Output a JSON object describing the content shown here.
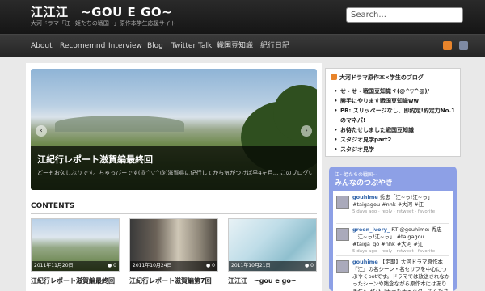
{
  "header": {
    "title": "江江江　~GOU E GO~",
    "tagline": "大河ドラマ「江~姫たちの戦国~」原作本学生応援サイト",
    "search_placeholder": "Search..."
  },
  "nav": {
    "items": [
      "About",
      "Recomemnd",
      "Interview",
      "Blog",
      "Twitter Talk",
      "戦国豆知識",
      "紀行日記"
    ]
  },
  "slider": {
    "title": "江紀行レポート滋賀編最終回",
    "excerpt": "どーもお久しぶりです。ちゃっぴーです(@^▽^@)滋賀県に紀行してから気がつけば早4ヶ月... このブログいつまで書いてるんだよと。更新サボりすぎなんだ高野(´・ω・`)はいすみません(´・ω・`)そんなだ...",
    "prev": "‹",
    "next": "›"
  },
  "contents": {
    "heading": "CONTENTS",
    "posts": [
      {
        "date": "2011年11月20日",
        "count": "0",
        "title": "江紀行レポート滋賀編最終回"
      },
      {
        "date": "2011年10月24日",
        "count": "0",
        "title": "江紀行レポート滋賀編第7回"
      },
      {
        "date": "2011年10月21日",
        "count": "0",
        "title": "江江江　~gou e go~"
      }
    ]
  },
  "sidebar": {
    "blog_title": "大河ドラマ原作本×学生のブログ",
    "blog_items": [
      "せ・せ・戦国豆知識ヾ(@^▽^@)/",
      "勝手にやります戦国豆知識ww",
      "PR: スリッページなし、即約定!約定力No.1のマネパ!",
      "お待たせしました戦国豆知識",
      "スタジオ見学part2",
      "スタジオ見学"
    ],
    "twitter": {
      "subtitle": "江~姫たちの戦国~",
      "title": "みんなのつぶやき",
      "tweets": [
        {
          "user": "gouhime",
          "text": " 秀忠「江~っ!江~っ」#taigagou #nhk #大河 #江",
          "meta": "5 days ago · reply · retweet · favorite"
        },
        {
          "user": "green_ivory_",
          "text": " RT @gouhime: 秀忠「江~っ!江~っ」 #taigagou #taiga_go #nhk #大河 #江",
          "meta": "5 days ago · reply · retweet · favorite"
        },
        {
          "user": "gouhime",
          "text": " 【定期】大河ドラマ原作本『江』の名シーン・名セリフを中心につぶやくbotです。ドラマでは放送されなかったシーンや残念ながら原作本にはありません!ぜひコチラもチェックしてください",
          "meta": ""
        }
      ]
    }
  },
  "colors": {
    "header_bg": "#1b1b1b",
    "twitter_widget": "#8da0e6",
    "rss": "#e8842b"
  }
}
